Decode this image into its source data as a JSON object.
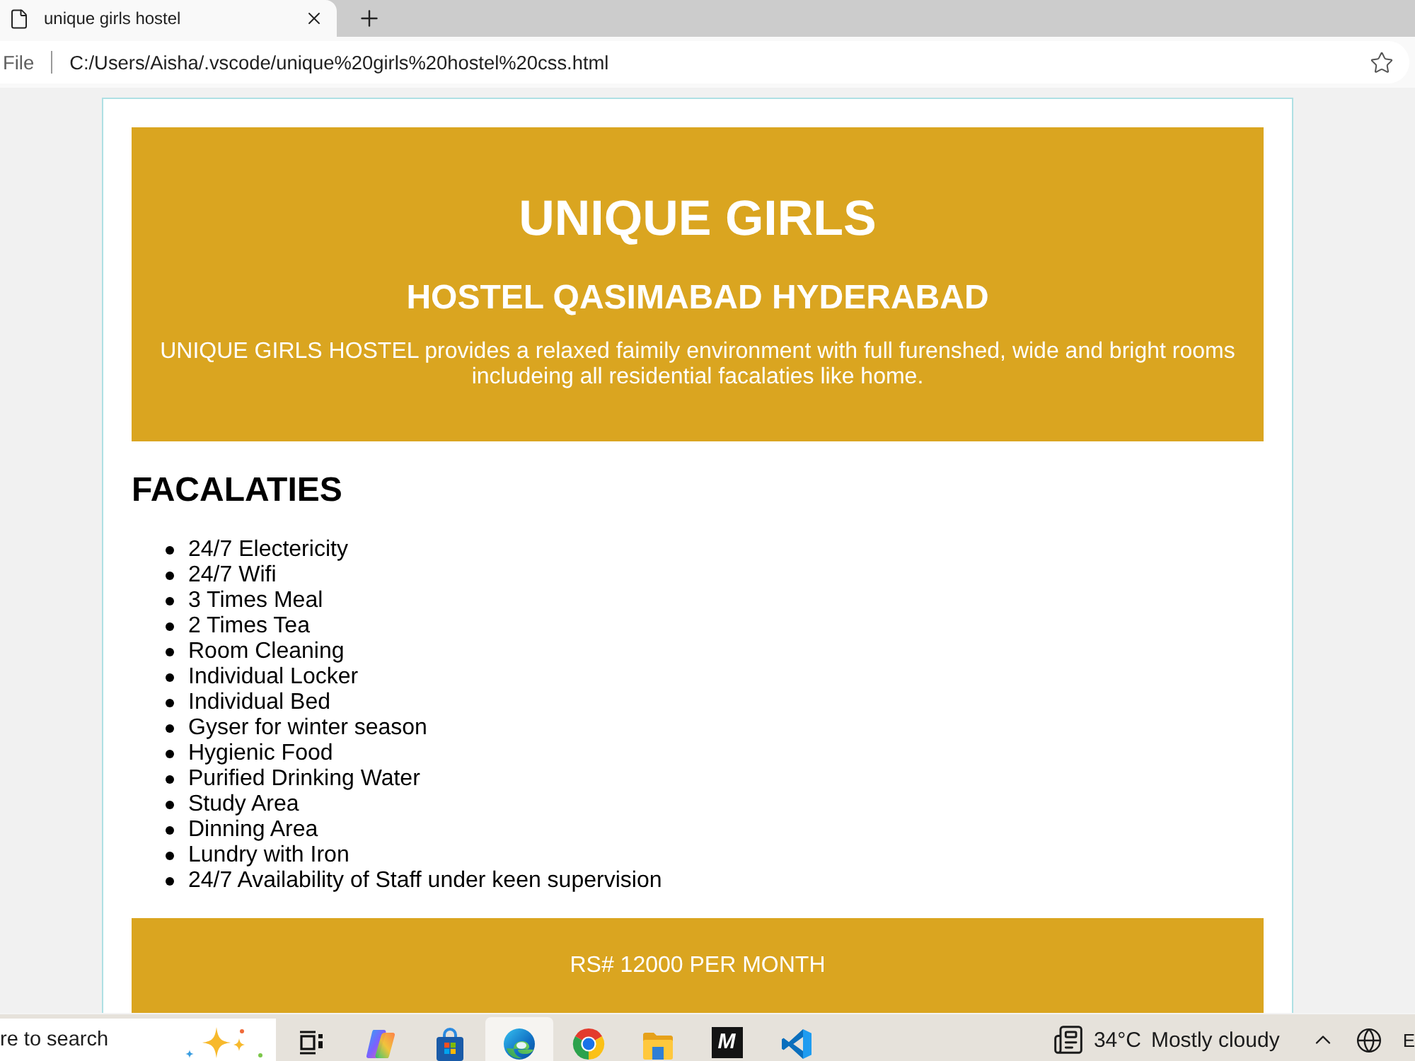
{
  "browser": {
    "tab": {
      "title": "unique girls hostel"
    },
    "address_bar": {
      "scheme": "File",
      "url": "C:/Users/Aisha/.vscode/unique%20girls%20hostel%20css.html"
    }
  },
  "page": {
    "header": {
      "title": "UNIQUE GIRLS",
      "subtitle": "HOSTEL QASIMABAD HYDERABAD",
      "description": "UNIQUE GIRLS HOSTEL provides a relaxed faimily environment with full furenshed, wide and bright rooms includeing all residential facalaties like home."
    },
    "facilities": {
      "heading": "FACALATIES",
      "items": [
        "24/7 Electericity",
        "24/7 Wifi",
        "3 Times Meal",
        "2 Times Tea",
        "Room Cleaning",
        "Individual Locker",
        "Individual Bed",
        "Gyser for winter season",
        "Hygienic Food",
        "Purified Drinking Water",
        "Study Area",
        "Dinning Area",
        "Lundry with Iron",
        "24/7 Availability of Staff under keen supervision"
      ]
    },
    "price_banner": {
      "text": "RS# 12000 PER MONTH"
    }
  },
  "taskbar": {
    "search": {
      "placeholder": "re to search"
    },
    "apps": [
      {
        "kind": "taskview",
        "selected": false
      },
      {
        "kind": "swirl",
        "selected": false
      },
      {
        "kind": "bag",
        "selected": false
      },
      {
        "kind": "wave",
        "selected": true
      },
      {
        "kind": "tricolor",
        "selected": false
      },
      {
        "kind": "folder",
        "selected": false
      },
      {
        "kind": "letter",
        "label": "M",
        "selected": false
      },
      {
        "kind": "ribbon",
        "selected": false
      }
    ],
    "weather": {
      "temperature": "34°C",
      "condition": "Mostly cloudy"
    },
    "language": "E"
  }
}
